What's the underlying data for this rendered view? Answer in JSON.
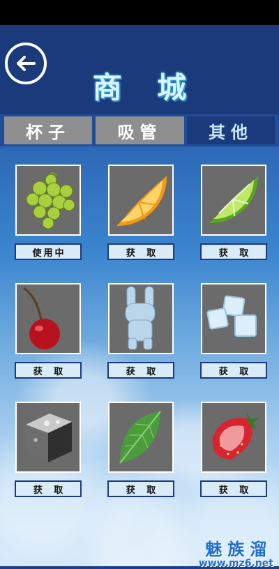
{
  "header": {
    "title": "商 城"
  },
  "tabs": [
    {
      "label": "杯子",
      "active": false
    },
    {
      "label": "吸管",
      "active": false
    },
    {
      "label": "其他",
      "active": true
    }
  ],
  "items": [
    {
      "name": "grapes",
      "action_label": "使用中"
    },
    {
      "name": "orange-slice",
      "action_label": "获 取"
    },
    {
      "name": "lime-slice",
      "action_label": "获 取"
    },
    {
      "name": "cherry",
      "action_label": "获 取"
    },
    {
      "name": "ice-bunny",
      "action_label": "获 取"
    },
    {
      "name": "ice-cubes",
      "action_label": "获 取"
    },
    {
      "name": "metal-ice-cube",
      "action_label": "获 取"
    },
    {
      "name": "mint-leaf",
      "action_label": "获 取"
    },
    {
      "name": "strawberry",
      "action_label": "获 取"
    }
  ],
  "watermark": {
    "text": "魅族溜",
    "url": "www.mz6.net"
  },
  "colors": {
    "header": "#1b3a7c",
    "tab_inactive": "#8f8f8f",
    "card": "#6b6b6b",
    "button": "#d8ebf7"
  }
}
